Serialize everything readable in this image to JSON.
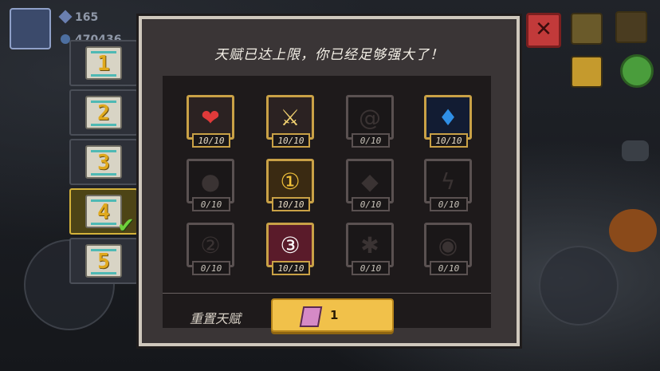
{
  "hud": {
    "gems": "165",
    "coins": "470436"
  },
  "tabs": [
    {
      "label": "1",
      "active": false
    },
    {
      "label": "2",
      "active": false
    },
    {
      "label": "3",
      "active": false
    },
    {
      "label": "4",
      "active": true
    },
    {
      "label": "5",
      "active": false
    }
  ],
  "panel": {
    "title": "天赋已达上限，你已经足够强大了！",
    "reset_label": "重置天赋",
    "reset_cost": "1"
  },
  "talents": [
    {
      "name": "heart-icon",
      "count": "10/10",
      "unlocked": true
    },
    {
      "name": "sword-icon",
      "count": "10/10",
      "unlocked": true
    },
    {
      "name": "swirl-icon",
      "count": "0/10",
      "unlocked": false
    },
    {
      "name": "blue-flame-icon",
      "count": "10/10",
      "unlocked": true
    },
    {
      "name": "bomb-icon",
      "count": "0/10",
      "unlocked": false
    },
    {
      "name": "key-one-icon",
      "count": "10/10",
      "unlocked": true
    },
    {
      "name": "shield-icon",
      "count": "0/10",
      "unlocked": false
    },
    {
      "name": "lightning-icon",
      "count": "0/10",
      "unlocked": false
    },
    {
      "name": "two-icon",
      "count": "0/10",
      "unlocked": false
    },
    {
      "name": "three-orb-icon",
      "count": "10/10",
      "unlocked": true
    },
    {
      "name": "spider-icon",
      "count": "0/10",
      "unlocked": false
    },
    {
      "name": "eye-icon",
      "count": "0/10",
      "unlocked": false
    }
  ]
}
